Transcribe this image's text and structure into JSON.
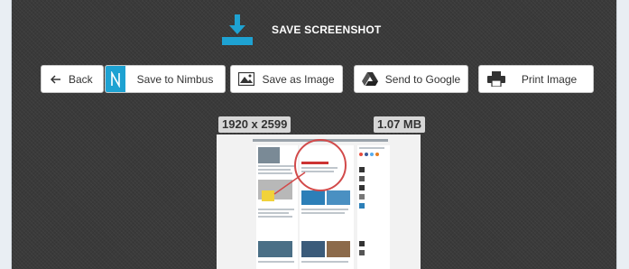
{
  "header": {
    "title": "SAVE SCREENSHOT"
  },
  "toolbar": {
    "back_label": "Back",
    "nimbus_label": "Save to Nimbus",
    "image_label": "Save as Image",
    "google_label": "Send to Google",
    "print_label": "Print Image"
  },
  "info": {
    "dimensions": "1920 x 2599",
    "filesize": "1.07 MB"
  },
  "colors": {
    "accent": "#1ea2d2",
    "panel": "#3a3a3a"
  },
  "icons": [
    "download-icon",
    "back-arrow-icon",
    "nimbus-icon",
    "image-icon",
    "google-drive-icon",
    "printer-icon"
  ]
}
